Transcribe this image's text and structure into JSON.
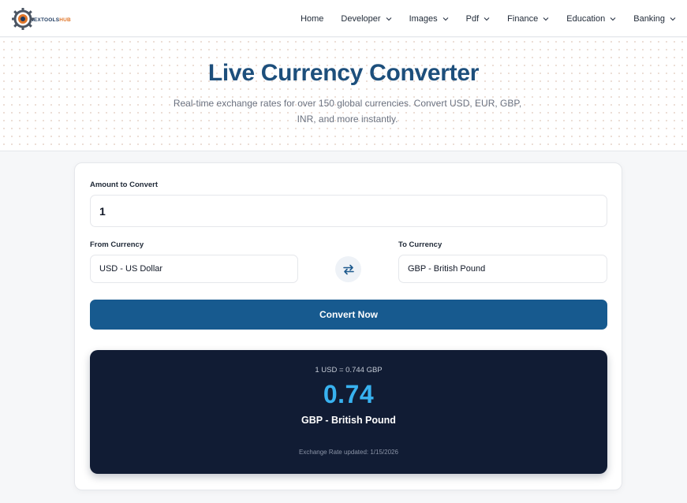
{
  "brand": {
    "logo_part1": "NEXTOOLS",
    "logo_part2": "HUB"
  },
  "nav": {
    "items": [
      {
        "label": "Home",
        "has_dropdown": false
      },
      {
        "label": "Developer",
        "has_dropdown": true
      },
      {
        "label": "Images",
        "has_dropdown": true
      },
      {
        "label": "Pdf",
        "has_dropdown": true
      },
      {
        "label": "Finance",
        "has_dropdown": true
      },
      {
        "label": "Education",
        "has_dropdown": true
      },
      {
        "label": "Banking",
        "has_dropdown": true
      }
    ]
  },
  "hero": {
    "title": "Live Currency Converter",
    "subtitle": "Real-time exchange rates for over 150 global currencies. Convert USD, EUR, GBP, INR, and more instantly."
  },
  "converter": {
    "amount_label": "Amount to Convert",
    "amount_value": "1",
    "from_label": "From Currency",
    "from_value": "USD - US Dollar",
    "to_label": "To Currency",
    "to_value": "GBP - British Pound",
    "swap_icon": "swap-arrows-icon",
    "convert_label": "Convert Now"
  },
  "result": {
    "rate_line": "1 USD = 0.744 GBP",
    "value": "0.74",
    "currency": "GBP - British Pound",
    "updated": "Exchange Rate updated: 1/15/2026"
  },
  "colors": {
    "primary": "#175a8f",
    "title": "#1d4f7c",
    "result_bg": "#111c34",
    "result_value": "#38b2f0",
    "accent_orange": "#e0762a"
  }
}
